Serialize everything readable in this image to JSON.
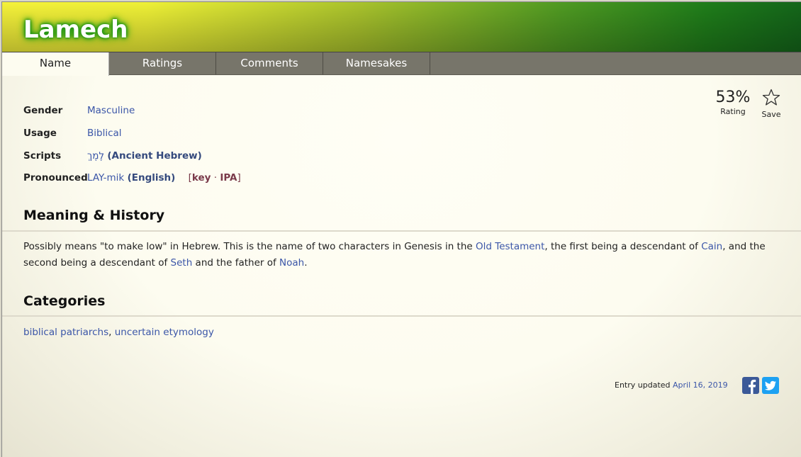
{
  "header": {
    "title": "Lamech"
  },
  "tabs": [
    {
      "label": "Name"
    },
    {
      "label": "Ratings"
    },
    {
      "label": "Comments"
    },
    {
      "label": "Namesakes"
    }
  ],
  "rating": {
    "value": "53%",
    "label": "Rating",
    "save_label": "Save"
  },
  "info": {
    "gender_label": "Gender",
    "gender_value": "Masculine",
    "usage_label": "Usage",
    "usage_value": "Biblical",
    "scripts_label": "Scripts",
    "scripts_text": "לֶמֶךְ",
    "scripts_lang": "(Ancient Hebrew)",
    "pronounced_label": "Pronounced",
    "pronounced_value": "LAY-mik",
    "pronounced_lang": "(English)",
    "key_open": "[",
    "key_link": "key",
    "key_sep": " · ",
    "ipa_link": "IPA",
    "key_close": "]"
  },
  "meaning": {
    "heading": "Meaning & History",
    "p1": "Possibly means \"to make low\" in Hebrew. This is the name of two characters in Genesis in the ",
    "link1": "Old Testament",
    "p2": ", the first being a descendant of ",
    "link2": "Cain",
    "p3": ", and the second being a descendant of ",
    "link3": "Seth",
    "p4": " and the father of ",
    "link4": "Noah",
    "p5": "."
  },
  "categories": {
    "heading": "Categories",
    "items": [
      "biblical patriarchs",
      "uncertain etymology"
    ],
    "separator": ", "
  },
  "footer": {
    "updated_label": "Entry updated ",
    "updated_date": "April 16, 2019"
  },
  "icons": {
    "star": "star-outline-icon",
    "facebook": "facebook-icon",
    "twitter": "twitter-icon"
  }
}
